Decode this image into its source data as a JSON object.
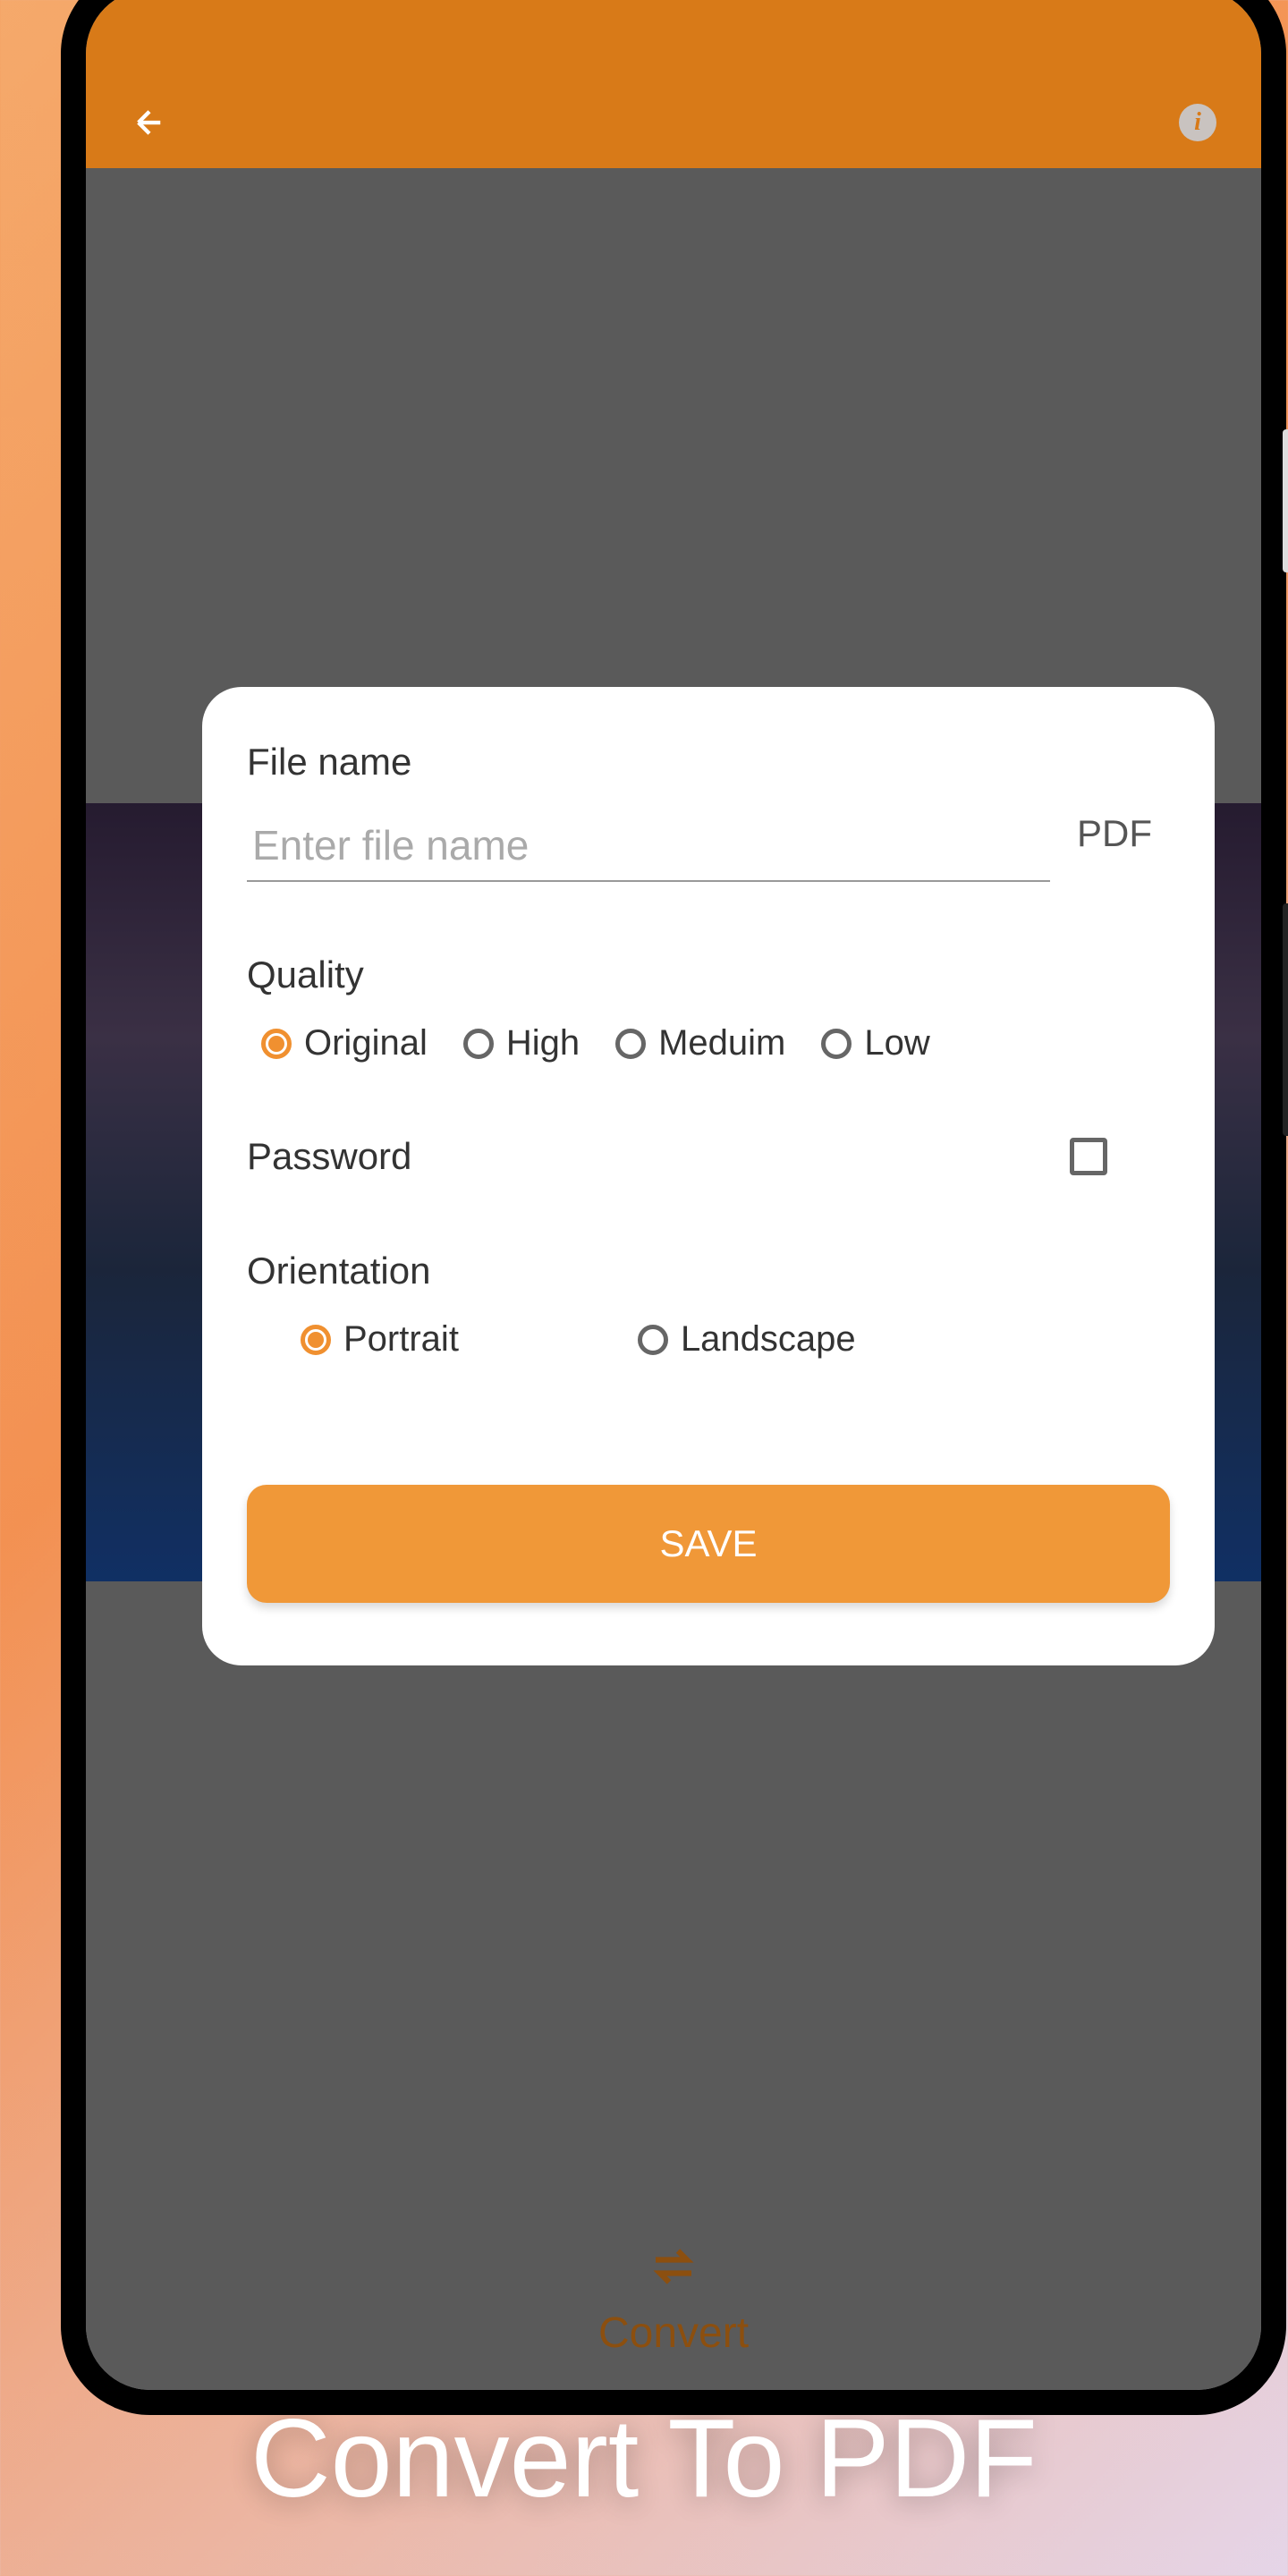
{
  "dialog": {
    "filename_label": "File name",
    "filename_placeholder": "Enter file name",
    "filename_value": "",
    "extension_label": "PDF",
    "quality_label": "Quality",
    "quality_options": {
      "original": "Original",
      "high": "High",
      "medium": "Meduim",
      "low": "Low"
    },
    "quality_selected": "original",
    "password_label": "Password",
    "password_checked": false,
    "orientation_label": "Orientation",
    "orientation_options": {
      "portrait": "Portrait",
      "landscape": "Landscape"
    },
    "orientation_selected": "portrait",
    "save_button": "SAVE"
  },
  "app": {
    "convert_label": "Convert"
  },
  "footer": {
    "tagline": "Convert To PDF"
  }
}
